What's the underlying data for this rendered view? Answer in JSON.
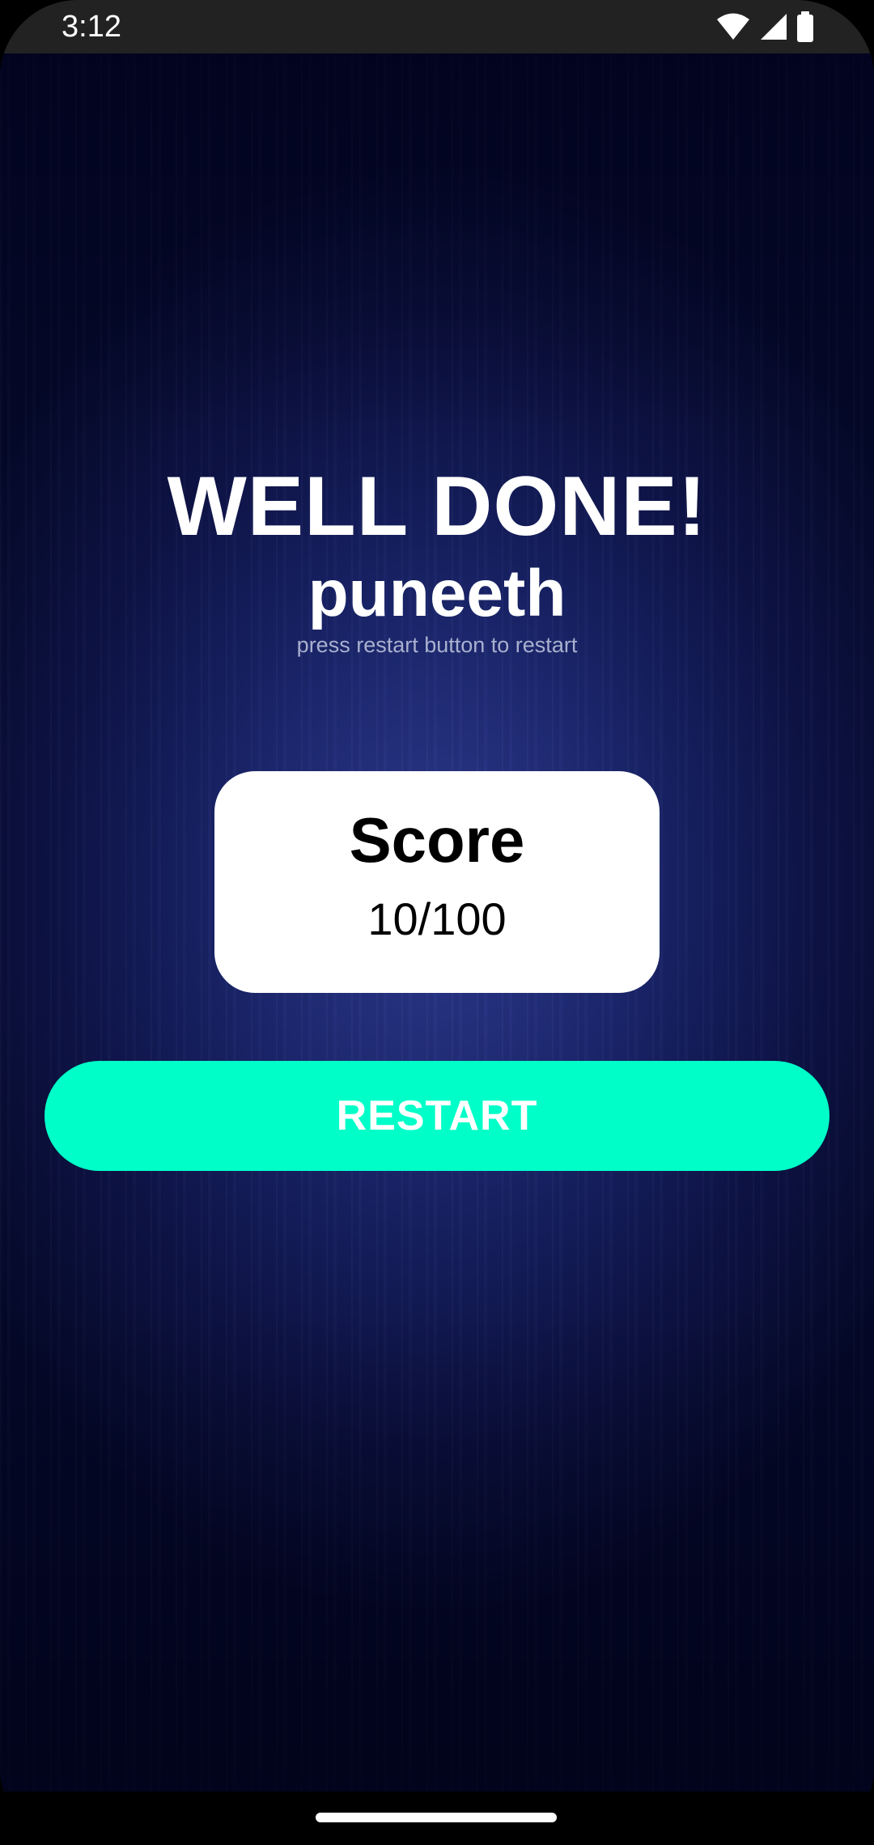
{
  "status_bar": {
    "time": "3:12",
    "icons": [
      "wifi-icon",
      "signal-icon",
      "battery-icon"
    ]
  },
  "result": {
    "title": "WELL DONE!",
    "player_name": "puneeth",
    "hint": "press restart button to restart"
  },
  "score_card": {
    "label": "Score",
    "value": "10/100"
  },
  "actions": {
    "restart_label": "RESTART"
  },
  "colors": {
    "accent": "#00ffc8",
    "background": "#0b1456",
    "card": "#ffffff"
  }
}
